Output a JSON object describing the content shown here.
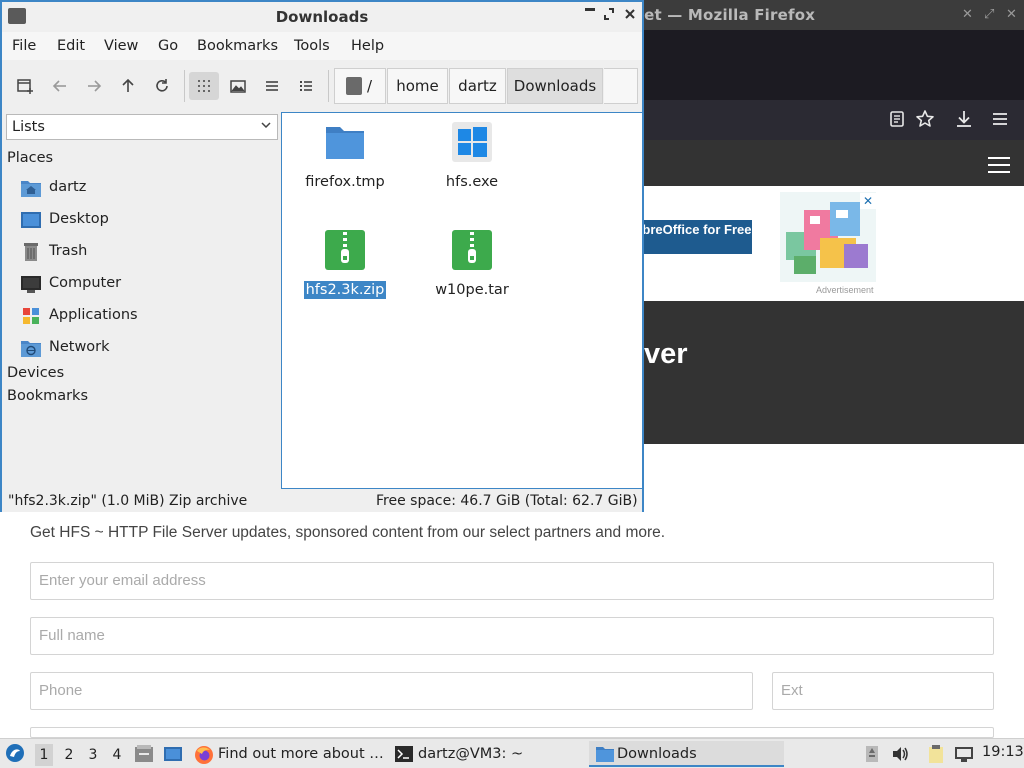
{
  "firefox": {
    "title": "ge.net — Mozilla Firefox",
    "ad_text": "load LibreOffice for Free",
    "ad_tag": "Advertisement",
    "hero_text": "ver",
    "newsletter_text": "Get HFS ~ HTTP File Server updates, sponsored content from our select partners and more.",
    "fields": {
      "email_placeholder": "Enter your email address",
      "name_placeholder": "Full name",
      "phone_placeholder": "Phone",
      "ext_placeholder": "Ext"
    }
  },
  "file_manager": {
    "title": "Downloads",
    "menu": [
      "File",
      "Edit",
      "View",
      "Go",
      "Bookmarks",
      "Tools",
      "Help"
    ],
    "breadcrumbs": [
      "/",
      "home",
      "dartz",
      "Downloads"
    ],
    "side_pane_mode": "Lists",
    "places_heading": "Places",
    "places": [
      "dartz",
      "Desktop",
      "Trash",
      "Computer",
      "Applications",
      "Network"
    ],
    "devices_heading": "Devices",
    "bookmarks_heading": "Bookmarks",
    "files": [
      {
        "name": "firefox.tmp",
        "icon": "folder-icon",
        "selected": false
      },
      {
        "name": "hfs.exe",
        "icon": "windows-executable-icon",
        "selected": false
      },
      {
        "name": "hfs2.3k.zip",
        "icon": "zip-archive-icon",
        "selected": true
      },
      {
        "name": "w10pe.tar",
        "icon": "tar-archive-icon",
        "selected": false
      }
    ],
    "status_left": "\"hfs2.3k.zip\" (1.0 MiB) Zip archive",
    "status_right": "Free space: 46.7 GiB (Total: 62.7 GiB)",
    "accent_color": "#3d86c6"
  },
  "taskbar": {
    "workspaces": [
      "1",
      "2",
      "3",
      "4"
    ],
    "tasks": [
      {
        "label": "Find out more about …",
        "icon": "firefox-icon"
      },
      {
        "label": "dartz@VM3: ~",
        "icon": "terminal-icon"
      },
      {
        "label": "Downloads",
        "icon": "folder-icon"
      }
    ],
    "clock": "19:13"
  }
}
